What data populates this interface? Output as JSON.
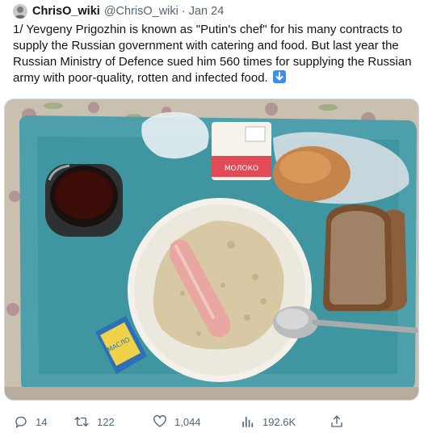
{
  "tweet": {
    "display_name": "ChrisO_wiki",
    "handle": "@ChrisO_wiki",
    "separator": "·",
    "date": "Jan 24",
    "text": "1/ Yevgeny Prigozhin is known as \"Putin's chef\" for his many contracts to supply the Russian government with catering and food. But last year the Russian Ministry of Defence sued him 560 times for supplying the Russian army with poor-quality, rotten and infected food.",
    "text_emoji": "down-arrow-icon"
  },
  "media": {
    "milk_carton_brand": "Молоко",
    "milk_carton_label": "МОЛОКО",
    "butter_label": "МАСЛО"
  },
  "actions": {
    "replies": "14",
    "retweets": "122",
    "likes": "1,044",
    "views": "192.6K"
  },
  "icons": {
    "reply": "reply-icon",
    "retweet": "retweet-icon",
    "like": "heart-icon",
    "views": "views-icon",
    "share": "share-icon",
    "accent": "#1d9bf0",
    "muted": "#536471"
  }
}
